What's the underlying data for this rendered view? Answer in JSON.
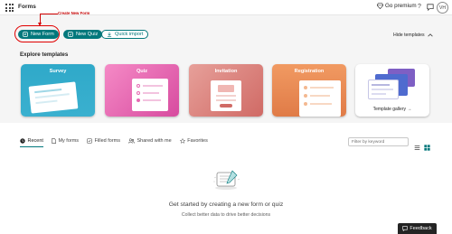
{
  "app": {
    "title": "Forms"
  },
  "header": {
    "premium_label": "Go premium",
    "help_label": "?",
    "avatar_initials": "VH"
  },
  "annotation": {
    "text": "Create New Form",
    "color": "#d00000"
  },
  "actions": {
    "new_form": "New Form",
    "new_quiz": "New Quiz",
    "quick_import": "Quick import",
    "hide_templates": "Hide templates"
  },
  "templates": {
    "heading": "Explore templates",
    "items": [
      {
        "label": "Survey",
        "color": "#35aecd"
      },
      {
        "label": "Quiz",
        "color": "#e56ab2"
      },
      {
        "label": "Invitation",
        "color": "#dd8781"
      },
      {
        "label": "Registration",
        "color": "#ea8b55"
      }
    ],
    "gallery_label": "Template gallery"
  },
  "tabs": [
    {
      "label": "Recent",
      "active": true
    },
    {
      "label": "My forms"
    },
    {
      "label": "Filled forms"
    },
    {
      "label": "Shared with me"
    },
    {
      "label": "Favorites"
    }
  ],
  "filter": {
    "placeholder": "Filter by keyword"
  },
  "empty_state": {
    "title": "Get started by creating a new form or quiz",
    "subtitle": "Collect better data to drive better decisions"
  },
  "feedback": {
    "label": "Feedback"
  },
  "colors": {
    "accent": "#03787c",
    "annotation": "#d00000"
  }
}
